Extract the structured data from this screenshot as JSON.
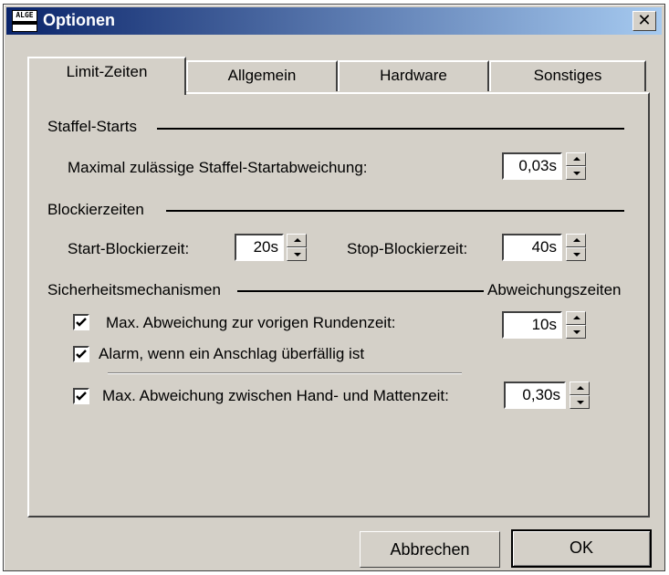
{
  "window": {
    "title": "Optionen",
    "icon": "algge-timing-logo",
    "icon_text": "ALGE TIMING"
  },
  "tabs": [
    {
      "label": "Limit-Zeiten",
      "active": true
    },
    {
      "label": "Allgemein",
      "active": false
    },
    {
      "label": "Hardware",
      "active": false
    },
    {
      "label": "Sonstiges",
      "active": false
    }
  ],
  "staffel": {
    "heading": "Staffel-Starts",
    "max_label": "Maximal zulässige Staffel-Startabweichung:",
    "max_value": "0,03s"
  },
  "blockier": {
    "heading": "Blockierzeiten",
    "start_label": "Start-Blockierzeit:",
    "start_value": "20s",
    "stop_label": "Stop-Blockierzeit:",
    "stop_value": "40s"
  },
  "sicherheit": {
    "heading": "Sicherheitsmechanismen",
    "column_label": "Abweichungszeiten",
    "rundenzeit_label": "Max. Abweichung zur vorigen Rundenzeit:",
    "rundenzeit_checked": true,
    "rundenzeit_value": "10s",
    "alarm_label": "Alarm, wenn ein Anschlag überfällig ist",
    "alarm_checked": true,
    "hand_label": "Max. Abweichung zwischen Hand- und Mattenzeit:",
    "hand_checked": true,
    "hand_value": "0,30s"
  },
  "buttons": {
    "cancel": "Abbrechen",
    "ok": "OK"
  },
  "colors": {
    "title_start": "#0a246a",
    "title_end": "#a6caf0",
    "face": "#d4d0c8"
  }
}
